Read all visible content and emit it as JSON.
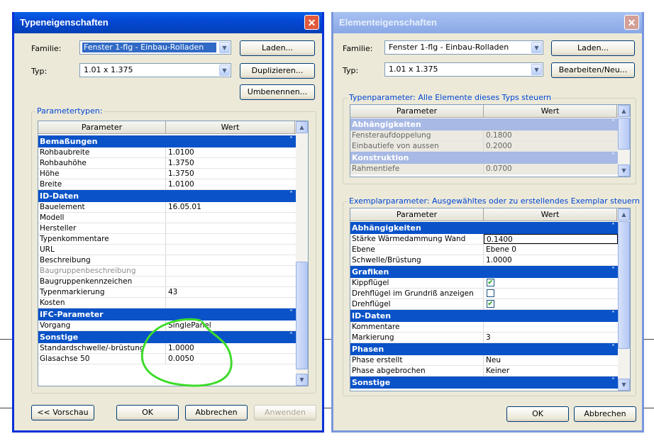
{
  "dialog1": {
    "title": "Typeneigenschaften",
    "familie_label": "Familie:",
    "familie_value": "Fenster 1-flg - Einbau-Rolladen",
    "typ_label": "Typ:",
    "typ_value": "1.01 x 1.375",
    "btn_laden": "Laden...",
    "btn_duplizieren": "Duplizieren...",
    "btn_umbenennen": "Umbenennen...",
    "group_title": "Parametertypen:",
    "col_param": "Parameter",
    "col_wert": "Wert",
    "rows": [
      {
        "type": "cat",
        "label": "Bemaßungen"
      },
      {
        "label": "Rohbaubreite",
        "value": "1.0100"
      },
      {
        "label": "Rohbauhöhe",
        "value": "1.3750"
      },
      {
        "label": "Höhe",
        "value": "1.3750"
      },
      {
        "label": "Breite",
        "value": "1.0100"
      },
      {
        "type": "cat",
        "label": "ID-Daten"
      },
      {
        "label": "Bauelement",
        "value": "16.05.01"
      },
      {
        "label": "Modell",
        "value": ""
      },
      {
        "label": "Hersteller",
        "value": ""
      },
      {
        "label": "Typenkommentare",
        "value": ""
      },
      {
        "label": "URL",
        "value": ""
      },
      {
        "label": "Beschreibung",
        "value": ""
      },
      {
        "label": "Baugruppenbeschreibung",
        "value": "",
        "dim": true
      },
      {
        "label": "Baugruppenkennzeichen",
        "value": ""
      },
      {
        "label": "Typenmarkierung",
        "value": "43"
      },
      {
        "label": "Kosten",
        "value": ""
      },
      {
        "type": "cat",
        "label": "IFC-Parameter"
      },
      {
        "label": "Vorgang",
        "value": "SinglePanel"
      },
      {
        "type": "cat",
        "label": "Sonstige"
      },
      {
        "label": "Standardschwelle/-brüstung",
        "value": "1.0000"
      },
      {
        "label": "Glasachse 50",
        "value": "0.0050"
      }
    ],
    "btn_vorschau": "<< Vorschau",
    "btn_ok": "OK",
    "btn_abbrechen": "Abbrechen",
    "btn_anwenden": "Anwenden"
  },
  "dialog2": {
    "title": "Elementeigenschaften",
    "familie_label": "Familie:",
    "familie_value": "Fenster 1-flg - Einbau-Rolladen",
    "typ_label": "Typ:",
    "typ_value": "1.01 x 1.375",
    "btn_laden": "Laden...",
    "btn_bearbeiten": "Bearbeiten/Neu...",
    "group1_title": "Typenparameter: Alle Elemente dieses Typs steuern",
    "group2_title": "Exemplarparameter: Ausgewähltes oder zu erstellendes Exemplar steuern",
    "col_param": "Parameter",
    "col_wert": "Wert",
    "type_rows": [
      {
        "type": "cat",
        "label": "Abhängigkeiten"
      },
      {
        "label": "Fensteraufdoppelung",
        "value": "0.1800"
      },
      {
        "label": "Einbautiefe von aussen",
        "value": "0.2000"
      },
      {
        "type": "cat",
        "label": "Konstruktion"
      },
      {
        "label": "Rahmentiefe",
        "value": "0.0700"
      }
    ],
    "inst_rows": [
      {
        "type": "cat",
        "label": "Abhängigkeiten"
      },
      {
        "label": "Stärke Wärmedammung Wand",
        "value": "0.1400",
        "edit": true
      },
      {
        "label": "Ebene",
        "value": "Ebene 0"
      },
      {
        "label": "Schwelle/Brüstung",
        "value": "1.0000"
      },
      {
        "type": "cat",
        "label": "Grafiken"
      },
      {
        "label": "Kippflügel",
        "check": true
      },
      {
        "label": "Drehflügel im Grundriß anzeigen",
        "check": false
      },
      {
        "label": "Drehflügel",
        "check": true
      },
      {
        "type": "cat",
        "label": "ID-Daten"
      },
      {
        "label": "Kommentare",
        "value": ""
      },
      {
        "label": "Markierung",
        "value": "3"
      },
      {
        "type": "cat",
        "label": "Phasen"
      },
      {
        "label": "Phase erstellt",
        "value": "Neu"
      },
      {
        "label": "Phase abgebrochen",
        "value": "Keiner"
      },
      {
        "type": "cat",
        "label": "Sonstige"
      }
    ],
    "btn_ok": "OK",
    "btn_abbrechen": "Abbrechen"
  }
}
